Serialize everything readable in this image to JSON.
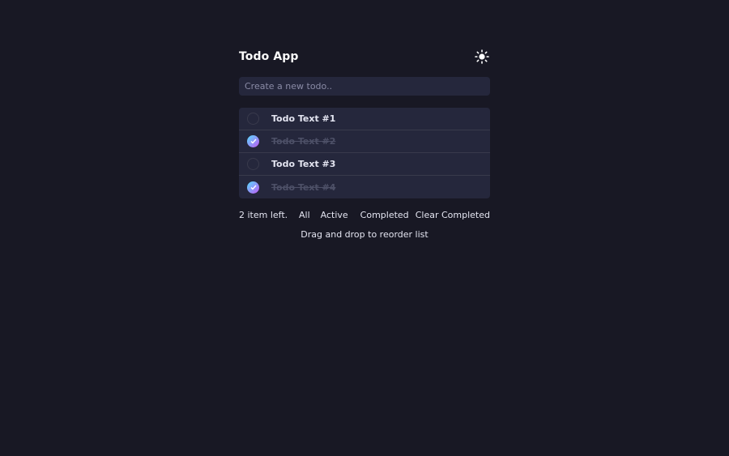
{
  "header": {
    "title": "Todo App",
    "theme_icon": "sun-icon"
  },
  "new_todo": {
    "placeholder": "Create a new todo..",
    "value": ""
  },
  "todos": [
    {
      "text": "Todo Text #1",
      "completed": false
    },
    {
      "text": "Todo Text #2",
      "completed": true
    },
    {
      "text": "Todo Text #3",
      "completed": false
    },
    {
      "text": "Todo Text #4",
      "completed": true
    }
  ],
  "footer": {
    "items_left": "2 item left.",
    "filters": [
      "All",
      "Active",
      "Completed"
    ],
    "clear_label": "Clear Completed"
  },
  "hint": "Drag and drop to reorder list",
  "colors": {
    "background": "#181824",
    "panel": "#25273c",
    "divider": "#393a4c",
    "check_gradient_start": "#57ddff",
    "check_gradient_end": "#c058f3",
    "completed_text": "#4d5067",
    "text": "#e4e5f1"
  }
}
